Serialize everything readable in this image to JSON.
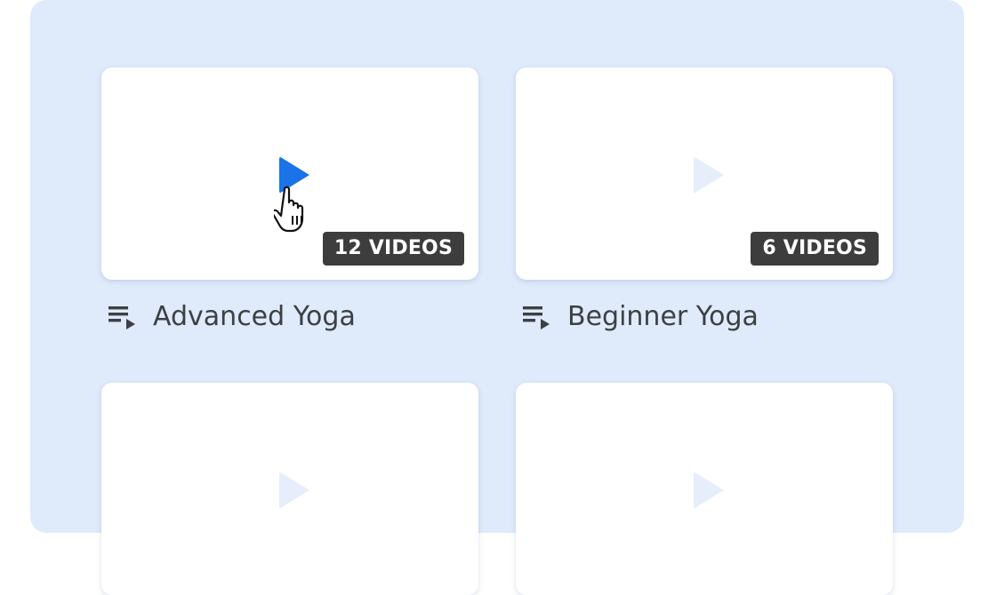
{
  "colors": {
    "panel_background": "#dfeafb",
    "card_background": "#ffffff",
    "play_active": "#1a73e8",
    "play_inactive": "#e6eefc",
    "badge_background": "#3d3d3d",
    "title_text": "#3c4043"
  },
  "playlists": [
    {
      "title": "Advanced Yoga",
      "badge": "12 VIDEOS",
      "icon": "playlist-play-icon",
      "play_icon": "play-icon",
      "hovered": true
    },
    {
      "title": "Beginner Yoga",
      "badge": "6 VIDEOS",
      "icon": "playlist-play-icon",
      "play_icon": "play-icon",
      "hovered": false
    },
    {
      "play_icon": "play-icon"
    },
    {
      "play_icon": "play-icon"
    }
  ],
  "cursor": {
    "icon": "hand-pointer-icon"
  }
}
